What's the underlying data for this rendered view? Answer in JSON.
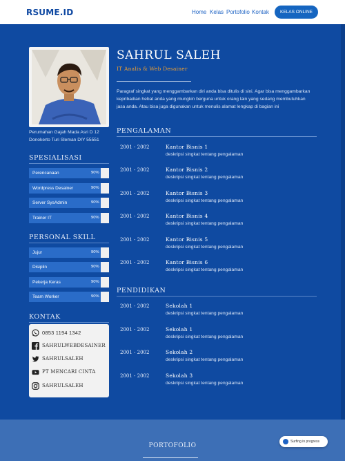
{
  "nav": {
    "logo": "RSUME.ID",
    "links": [
      "Home",
      "Kelas",
      "Portofolio",
      "Kontak"
    ],
    "cta": "KELAS ONLINE"
  },
  "profile": {
    "name": "SAHRUL SALEH",
    "role": "IT Analis & Web Desainer",
    "address_line1": "Perumahan Gajah Mada Asri D 12",
    "address_line2": "Donokerto Turi Sleman DIY 55551",
    "intro": "Paragraf singkat yang menggambarkan diri anda bisa ditulis di sini. Agar bisa menggambarkan kepribadian hebat anda yang mungkin berguna untuk orang lain yang sedang membutuhkan jasa anda. Atau bisa juga digunakan untuk menulis alamat lengkap di bagian ini"
  },
  "spesialisasi": {
    "title": "SPESIALISASI",
    "items": [
      {
        "label": "Perencanaan",
        "pct": "90%",
        "level": 0.9
      },
      {
        "label": "Wordpress Desainer",
        "pct": "90%",
        "level": 0.9
      },
      {
        "label": "Server SysAdmin",
        "pct": "90%",
        "level": 0.9
      },
      {
        "label": "Trainer IT",
        "pct": "90%",
        "level": 0.9
      }
    ]
  },
  "personal_skill": {
    "title": "PERSONAL SKILL",
    "items": [
      {
        "label": "Jujur",
        "pct": "90%",
        "level": 0.9
      },
      {
        "label": "Disiplin",
        "pct": "90%",
        "level": 0.9
      },
      {
        "label": "Pekerja Keras",
        "pct": "90%",
        "level": 0.9
      },
      {
        "label": "Team Worker",
        "pct": "90%",
        "level": 0.9
      }
    ]
  },
  "kontak": {
    "title": "KONTAK",
    "items": [
      {
        "icon": "whatsapp-icon",
        "text": "0853 1194 1342"
      },
      {
        "icon": "facebook-icon",
        "text": "SAHRULWEBDESAINER"
      },
      {
        "icon": "twitter-icon",
        "text": "SAHRULSALEH"
      },
      {
        "icon": "youtube-icon",
        "text": "PT MENCARI CINTA"
      },
      {
        "icon": "instagram-icon",
        "text": "SAHRULSALEH"
      }
    ]
  },
  "pengalaman": {
    "title": "PENGALAMAN",
    "items": [
      {
        "year": "2001 - 2002",
        "title": "Kantor Bisnis 1",
        "desc": "deskripsi singkat tentang pengalaman"
      },
      {
        "year": "2001 - 2002",
        "title": "Kantor Bisnis 2",
        "desc": "deskripsi singkat tentang pengalaman"
      },
      {
        "year": "2001 - 2002",
        "title": "Kantor Bisnis 3",
        "desc": "deskripsi singkat tentang pengalaman"
      },
      {
        "year": "2001 - 2002",
        "title": "Kantor Bisnis 4",
        "desc": "deskripsi singkat tentang pengalaman"
      },
      {
        "year": "2001 - 2002",
        "title": "Kantor Bisnis 5",
        "desc": "deskripsi singkat tentang pengalaman"
      },
      {
        "year": "2001 - 2002",
        "title": "Kantor Bisnis 6",
        "desc": "deskripsi singkat tentang pengalaman"
      }
    ]
  },
  "pendidikan": {
    "title": "PENDIDIKAN",
    "items": [
      {
        "year": "2001 - 2002",
        "title": "Sekolah 1",
        "desc": "deskripsi singkat tentang pengalaman"
      },
      {
        "year": "2001 - 2002",
        "title": "Sekolah 1",
        "desc": "deskripsi singkat tentang pengalaman"
      },
      {
        "year": "2001 - 2002",
        "title": "Sekolah 2",
        "desc": "deskripsi singkat tentang pengalaman"
      },
      {
        "year": "2001 - 2002",
        "title": "Sekolah 3",
        "desc": "deskripsi singkat tentang pengalaman"
      }
    ]
  },
  "footer": {
    "title": "PORTOFOLIO",
    "toast": "Surfing in progress"
  },
  "colors": {
    "background": "#0f4aa1",
    "accent": "#f0a030",
    "skill_bar": "#2a6cc8"
  }
}
